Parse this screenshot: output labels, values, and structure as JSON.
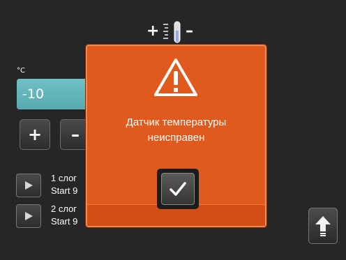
{
  "thermometer": {
    "plus": "+",
    "minus": "–"
  },
  "temperature": {
    "unit": "°C",
    "value": "-10"
  },
  "steppers": {
    "plus": "+",
    "minus": "–"
  },
  "layers": [
    {
      "line1": "1 слог",
      "line2": "Start 9"
    },
    {
      "line1": "2 слог",
      "line2": "Start 9"
    }
  ],
  "dialog": {
    "icon": "warning-triangle-icon",
    "message_line1": "Датчик температуры",
    "message_line2": "неисправен",
    "confirm_icon": "checkmark-icon"
  },
  "colors": {
    "background": "#262626",
    "dialog": "#e05a1d",
    "value_field": "#63b4ba"
  }
}
